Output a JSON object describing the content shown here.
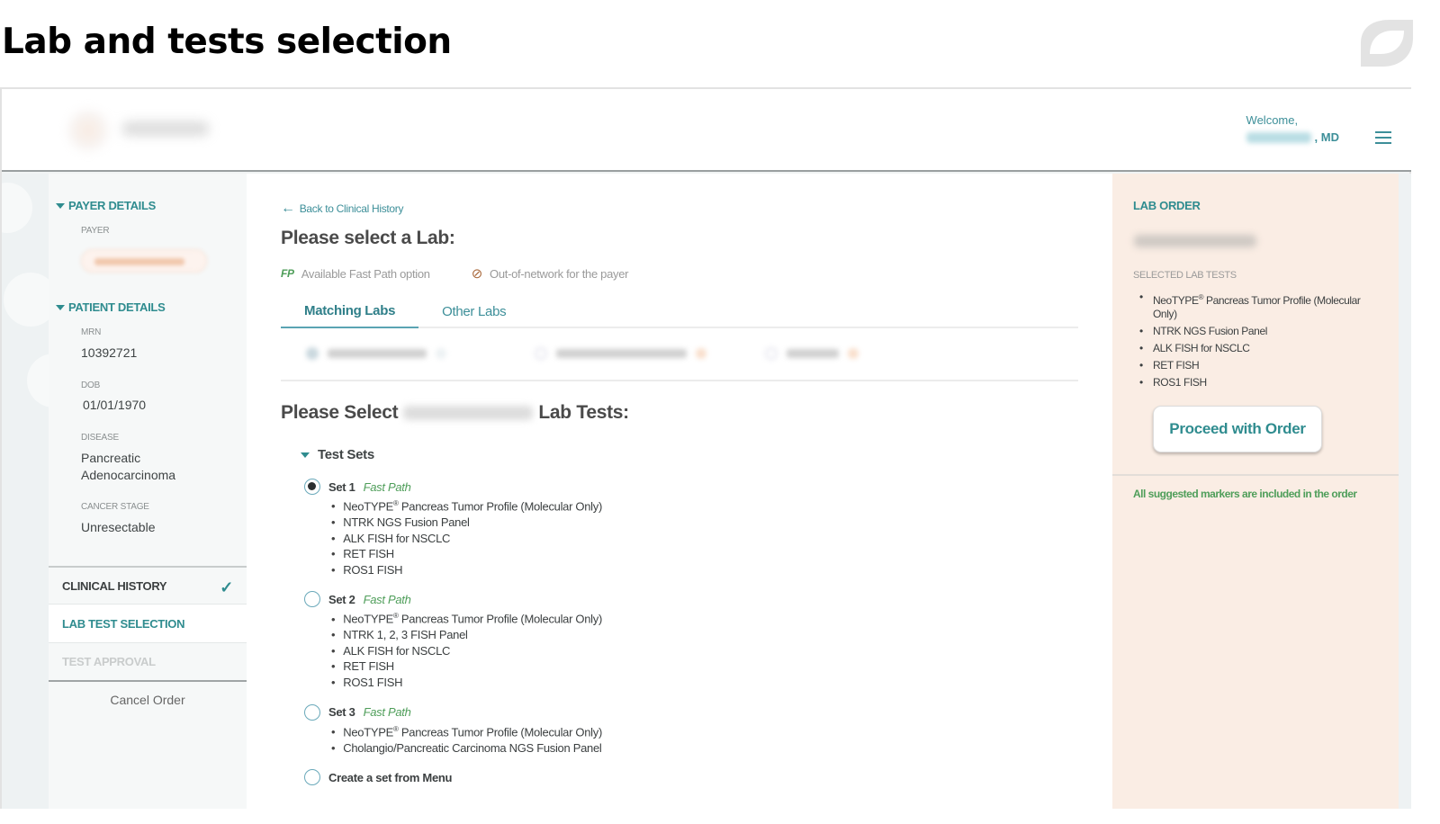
{
  "slide": {
    "title": "Lab and tests selection",
    "brand_icon": "leaf-logo-icon"
  },
  "header": {
    "logo": "blurred-app-logo",
    "welcome": "Welcome,",
    "user_suffix": ", MD",
    "menu_icon": "hamburger-menu-icon"
  },
  "sidebar": {
    "payer_section": {
      "title": "PAYER DETAILS",
      "payer_label": "PAYER"
    },
    "patient_section": {
      "title": "PATIENT DETAILS",
      "fields": [
        {
          "label": "MRN",
          "value": "10392721"
        },
        {
          "label": "DOB",
          "value": "01/01/1970"
        },
        {
          "label": "DISEASE",
          "value": "Pancreatic Adenocarcinoma"
        },
        {
          "label": "CANCER STAGE",
          "value": "Unresectable"
        }
      ]
    },
    "steps": [
      {
        "label": "CLINICAL HISTORY",
        "state": "done"
      },
      {
        "label": "LAB TEST SELECTION",
        "state": "active"
      },
      {
        "label": "TEST APPROVAL",
        "state": "disabled"
      }
    ],
    "cancel_label": "Cancel Order"
  },
  "main": {
    "back_link": "Back to Clinical History",
    "title": "Please select a Lab:",
    "legend": {
      "fp_badge": "FP",
      "fp_text": "Available Fast Path option",
      "out_of_network_text": "Out-of-network for the payer"
    },
    "tabs": [
      {
        "label": "Matching Labs",
        "active": true
      },
      {
        "label": "Other Labs",
        "active": false
      }
    ],
    "tests_title_prefix": "Please Select",
    "tests_title_suffix": "Lab Tests:",
    "test_sets_label": "Test Sets",
    "sets": [
      {
        "name": "Set 1",
        "tag": "Fast Path",
        "selected": true,
        "tests": [
          {
            "text": "NeoTYPE",
            "sup": "®",
            "rest": " Pancreas Tumor Profile (Molecular Only)"
          },
          {
            "text": "NTRK NGS Fusion Panel"
          },
          {
            "text": "ALK FISH for NSCLC"
          },
          {
            "text": "RET FISH"
          },
          {
            "text": "ROS1 FISH"
          }
        ]
      },
      {
        "name": "Set 2",
        "tag": "Fast Path",
        "selected": false,
        "tests": [
          {
            "text": "NeoTYPE",
            "sup": "®",
            "rest": " Pancreas Tumor Profile (Molecular Only)"
          },
          {
            "text": "NTRK 1, 2, 3 FISH Panel"
          },
          {
            "text": "ALK FISH for NSCLC"
          },
          {
            "text": "RET FISH"
          },
          {
            "text": "ROS1 FISH"
          }
        ]
      },
      {
        "name": "Set 3",
        "tag": "Fast Path",
        "selected": false,
        "tests": [
          {
            "text": "NeoTYPE",
            "sup": "®",
            "rest": " Pancreas Tumor Profile (Molecular Only)"
          },
          {
            "text": "Cholangio/Pancreatic Carcinoma NGS Fusion Panel"
          }
        ]
      }
    ],
    "create_set_label": "Create a set from Menu"
  },
  "lab_order": {
    "title": "LAB ORDER",
    "selected_label": "SELECTED LAB TESTS",
    "tests": [
      {
        "text": "NeoTYPE",
        "sup": "®",
        "rest": " Pancreas Tumor Profile (Molecular Only)"
      },
      {
        "text": "NTRK NGS Fusion Panel"
      },
      {
        "text": "ALK FISH for NSCLC"
      },
      {
        "text": "RET FISH"
      },
      {
        "text": "ROS1 FISH"
      }
    ],
    "proceed_label": "Proceed with Order",
    "note": "All suggested markers are included in the order"
  },
  "colors": {
    "teal": "#2f8c8f",
    "fast_path_green": "#4f9e5a",
    "order_panel_bg": "#faede4",
    "out_of_network": "#a9683b"
  }
}
